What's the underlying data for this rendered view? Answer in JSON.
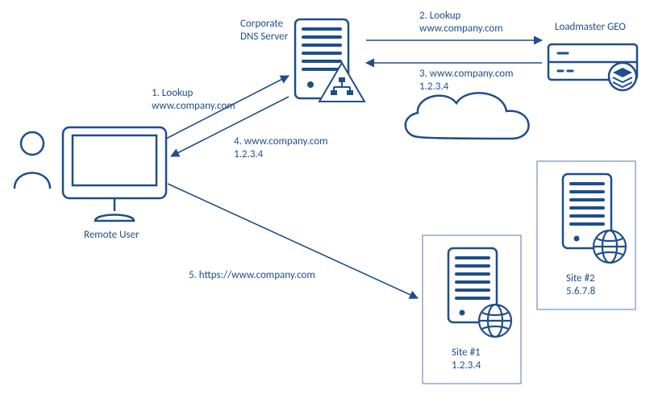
{
  "labels": {
    "remote_user": "Remote User",
    "corporate_dns_l1": "Corporate",
    "corporate_dns_l2": "DNS Server",
    "loadmaster": "Loadmaster GEO",
    "site1_name": "Site #1",
    "site1_ip": "1.2.3.4",
    "site2_name": "Site #2",
    "site2_ip": "5.6.7.8"
  },
  "steps": {
    "s1_l1": "1. Lookup",
    "s1_l2": "www.company.com",
    "s2_l1": "2. Lookup",
    "s2_l2": "www.company.com",
    "s3_l1": "3. www.company.com",
    "s3_l2": "1.2.3.4",
    "s4_l1": "4. www.company.com",
    "s4_l2": "1.2.3.4",
    "s5": "5. https://www.company.com"
  },
  "diagram": {
    "nodes": [
      {
        "id": "remote_user",
        "type": "user+monitor",
        "label": "Remote User"
      },
      {
        "id": "corporate_dns",
        "type": "dns-server",
        "label": "Corporate DNS Server"
      },
      {
        "id": "loadmaster",
        "type": "load-balancer",
        "label": "Loadmaster GEO"
      },
      {
        "id": "cloud",
        "type": "cloud",
        "label": ""
      },
      {
        "id": "site1",
        "type": "web-server",
        "label": "Site #1",
        "ip": "1.2.3.4"
      },
      {
        "id": "site2",
        "type": "web-server",
        "label": "Site #2",
        "ip": "5.6.7.8"
      }
    ],
    "edges": [
      {
        "step": 1,
        "from": "remote_user",
        "to": "corporate_dns",
        "text": "Lookup www.company.com"
      },
      {
        "step": 2,
        "from": "corporate_dns",
        "to": "loadmaster",
        "text": "Lookup www.company.com"
      },
      {
        "step": 3,
        "from": "loadmaster",
        "to": "corporate_dns",
        "text": "www.company.com 1.2.3.4"
      },
      {
        "step": 4,
        "from": "corporate_dns",
        "to": "remote_user",
        "text": "www.company.com 1.2.3.4"
      },
      {
        "step": 5,
        "from": "remote_user",
        "to": "site1",
        "text": "https://www.company.com"
      }
    ]
  }
}
